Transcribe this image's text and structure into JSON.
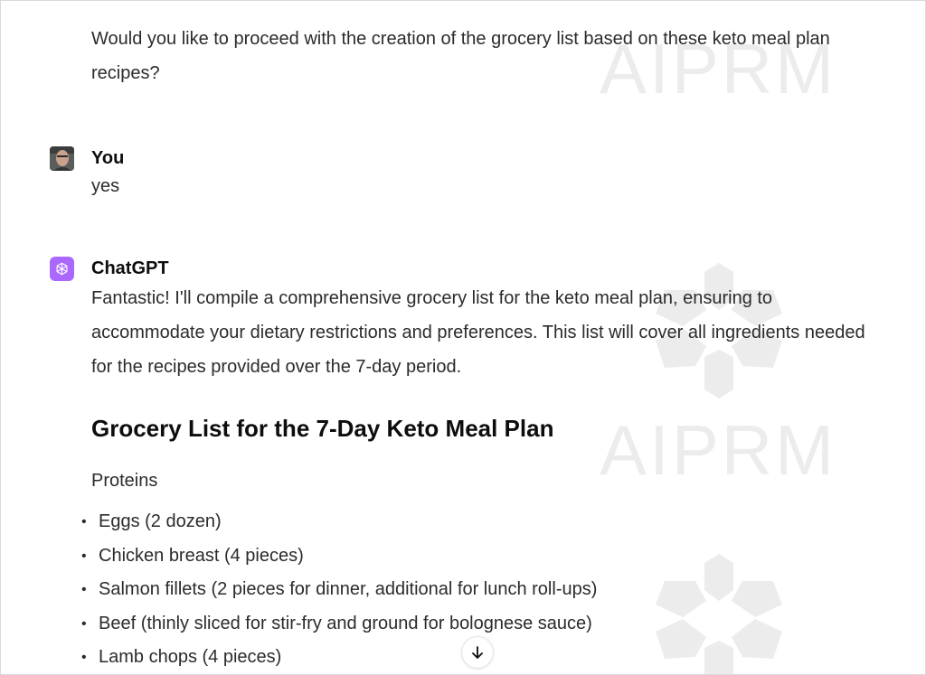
{
  "intro_text": "Would you like to proceed with the creation of the grocery list based on these keto meal plan recipes?",
  "watermark": {
    "text": "AIPRM"
  },
  "messages": {
    "user": {
      "author": "You",
      "text": "yes",
      "avatar_icon": "user-photo-avatar"
    },
    "assistant": {
      "author": "ChatGPT",
      "text": "Fantastic! I'll compile a comprehensive grocery list for the keto meal plan, ensuring to accommodate your dietary restrictions and preferences. This list will cover all ingredients needed for the recipes provided over the 7-day period.",
      "avatar_icon": "openai-logo-icon",
      "avatar_color": "#ab68ff"
    }
  },
  "grocery": {
    "heading": "Grocery List for the 7-Day Keto Meal Plan",
    "section": "Proteins",
    "items": [
      "Eggs (2 dozen)",
      "Chicken breast (4 pieces)",
      "Salmon fillets (2 pieces for dinner, additional for lunch roll-ups)",
      "Beef (thinly sliced for stir-fry and ground for bolognese sauce)",
      "Lamb chops (4 pieces)"
    ],
    "bullet": "•"
  },
  "scroll_button": {
    "icon": "arrow-down-icon",
    "glyph": "↓"
  }
}
